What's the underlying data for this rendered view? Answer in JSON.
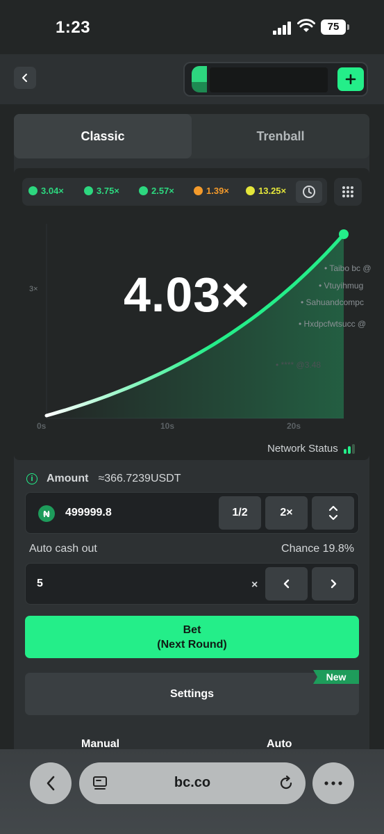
{
  "status_bar": {
    "time": "1:23",
    "battery": "75"
  },
  "game_tabs": [
    {
      "label": "Classic",
      "active": true
    },
    {
      "label": "Trenball",
      "active": false
    }
  ],
  "history": [
    {
      "value": "3.04×",
      "color": "#2dd77f"
    },
    {
      "value": "3.75×",
      "color": "#2dd77f"
    },
    {
      "value": "2.57×",
      "color": "#2dd77f"
    },
    {
      "value": "1.39×",
      "color": "#f39a2b"
    },
    {
      "value": "13.25×",
      "color": "#e4e63b"
    }
  ],
  "chart": {
    "multiplier": "4.03×",
    "y_tick": "3×",
    "x_ticks": [
      "0s",
      "10s",
      "20s"
    ],
    "players": [
      "Taibo bc @",
      "Vtuyihmug",
      "Sahuandcompc",
      "Hxdpcfwtsucc @",
      "**** @3.48"
    ],
    "network_status": "Network Status"
  },
  "chart_data": {
    "type": "line",
    "x": [
      0,
      4,
      8,
      12,
      16,
      20,
      24
    ],
    "y": [
      1.0,
      1.25,
      1.56,
      1.95,
      2.44,
      3.1,
      4.03
    ],
    "x_ticks": [
      "0s",
      "10s",
      "20s"
    ],
    "y_ticks": [
      "3×"
    ],
    "current_multiplier": "4.03×"
  },
  "bet": {
    "amount_label": "Amount",
    "amount_usd": "≈366.7239USDT",
    "amount_value": "499999.8",
    "coin_symbol": "₦",
    "half_label": "1/2",
    "double_label": "2×",
    "auto_cashout_label": "Auto cash out",
    "chance_label": "Chance 19.8%",
    "cashout_value": "5",
    "times_sign": "×",
    "bet_line1": "Bet",
    "bet_line2": "(Next Round)",
    "settings_label": "Settings",
    "new_badge": "New"
  },
  "mode_tabs": [
    "Manual",
    "Auto"
  ],
  "browser": {
    "url": "bc.co"
  }
}
